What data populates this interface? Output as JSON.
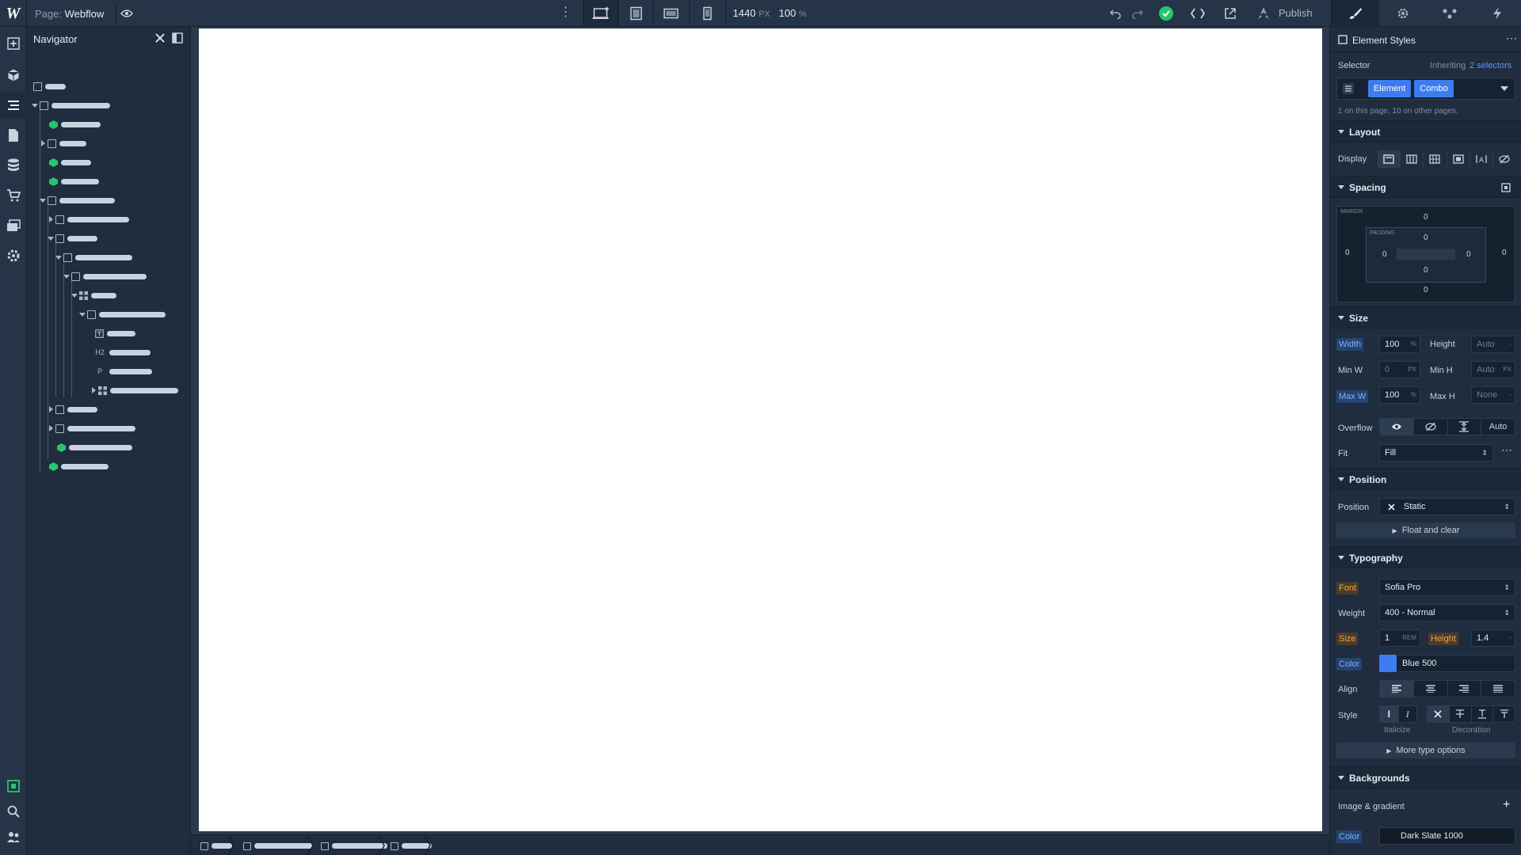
{
  "topbar": {
    "page_prefix": "Page:",
    "page_name": "Webflow",
    "width_value": "1440",
    "width_unit": "PX",
    "zoom_value": "100",
    "zoom_unit": "%",
    "publish_label": "Publish"
  },
  "navigator": {
    "title": "Navigator",
    "tags": {
      "h2": "H2",
      "p": "P"
    }
  },
  "panel": {
    "title": "Element Styles",
    "selector_label": "Selector",
    "inheriting_prefix": "Inheriting",
    "inheriting_link": "2 selectors",
    "element_chip": "Element",
    "combo_chip": "Combo",
    "usage_note": "1 on this page, 10 on other pages.",
    "layout": {
      "title": "Layout",
      "display_label": "Display"
    },
    "spacing": {
      "title": "Spacing",
      "margin_label": "MARGIN",
      "padding_label": "PADDING",
      "margin_top": "0",
      "margin_left": "0",
      "margin_right": "0",
      "margin_bottom": "0",
      "padding_top": "0",
      "padding_left": "0",
      "padding_right": "0",
      "padding_bottom": "0"
    },
    "size": {
      "title": "Size",
      "width_label": "Width",
      "width_value": "100",
      "width_unit": "%",
      "height_label": "Height",
      "height_value": "Auto",
      "height_unit": "-",
      "minw_label": "Min W",
      "minw_value": "0",
      "minw_unit": "PX",
      "minh_label": "Min H",
      "minh_value": "Auto",
      "minh_unit": "PX",
      "maxw_label": "Max W",
      "maxw_value": "100",
      "maxw_unit": "%",
      "maxh_label": "Max H",
      "maxh_value": "None",
      "maxh_unit": "-",
      "overflow_label": "Overflow",
      "overflow_auto": "Auto",
      "fit_label": "Fit",
      "fit_value": "Fill"
    },
    "position": {
      "title": "Position",
      "position_label": "Position",
      "position_value": "Static",
      "float_label": "Float and clear"
    },
    "typography": {
      "title": "Typography",
      "font_label": "Font",
      "font_value": "Sofia Pro",
      "weight_label": "Weight",
      "weight_value": "400 - Normal",
      "size_label": "Size",
      "size_value": "1",
      "size_unit": "REM",
      "height_label": "Height",
      "height_value": "1.4",
      "height_unit": "-",
      "color_label": "Color",
      "color_value": "Blue 500",
      "color_hex": "#3d7cf0",
      "align_label": "Align",
      "style_label": "Style",
      "italicize_label": "Italicize",
      "decoration_label": "Decoration",
      "more_label": "More type options"
    },
    "backgrounds": {
      "title": "Backgrounds",
      "image_label": "Image & gradient",
      "color_label": "Color",
      "color_value": "Dark Slate 1000"
    }
  }
}
